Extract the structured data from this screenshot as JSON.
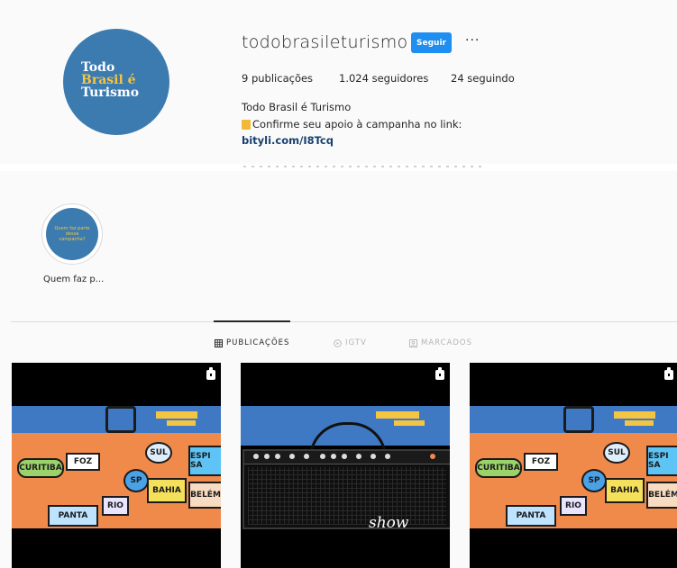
{
  "profile": {
    "avatar_lines": [
      "Todo",
      "Brasil é",
      "Turismo"
    ],
    "username": "todobrasileturismo",
    "follow_label": "Seguir",
    "more_label": "···",
    "stats": {
      "posts": "9 publicações",
      "followers": "1.024 seguidores",
      "following": "24 seguindo"
    },
    "full_name": "Todo Brasil é Turismo",
    "bio": "Confirme seu apoio à campanha no link:",
    "link": "bityli.com/I8Tcq"
  },
  "highlights": [
    {
      "label": "Quem faz p...",
      "inner_text": "Quem faz parte dessa campanha?"
    }
  ],
  "tabs": [
    {
      "label": "PUBLICAÇÕES",
      "icon": "grid-icon",
      "active": true
    },
    {
      "label": "IGTV",
      "icon": "igtv-icon",
      "active": false
    },
    {
      "label": "MARCADOS",
      "icon": "tagged-icon",
      "active": false
    }
  ],
  "posts": [
    {
      "type": "video",
      "stickers": [
        "CURITIBA",
        "FOZ",
        "SUL",
        "ESPI SA",
        "BAHIA",
        "BELÉM",
        "SP",
        "RIO",
        "PANTA"
      ]
    },
    {
      "type": "video",
      "script_text": "show"
    },
    {
      "type": "video",
      "stickers": [
        "CURITIBA",
        "FOZ",
        "SUL",
        "ESPI SA",
        "BAHIA",
        "BELÉM",
        "SP",
        "RIO",
        "PANTA"
      ]
    }
  ],
  "colors": {
    "avatar_bg": "#3b7bb0",
    "accent_yellow": "#f7c342",
    "follow_button": "#1e8ef0",
    "link": "#18406e"
  }
}
